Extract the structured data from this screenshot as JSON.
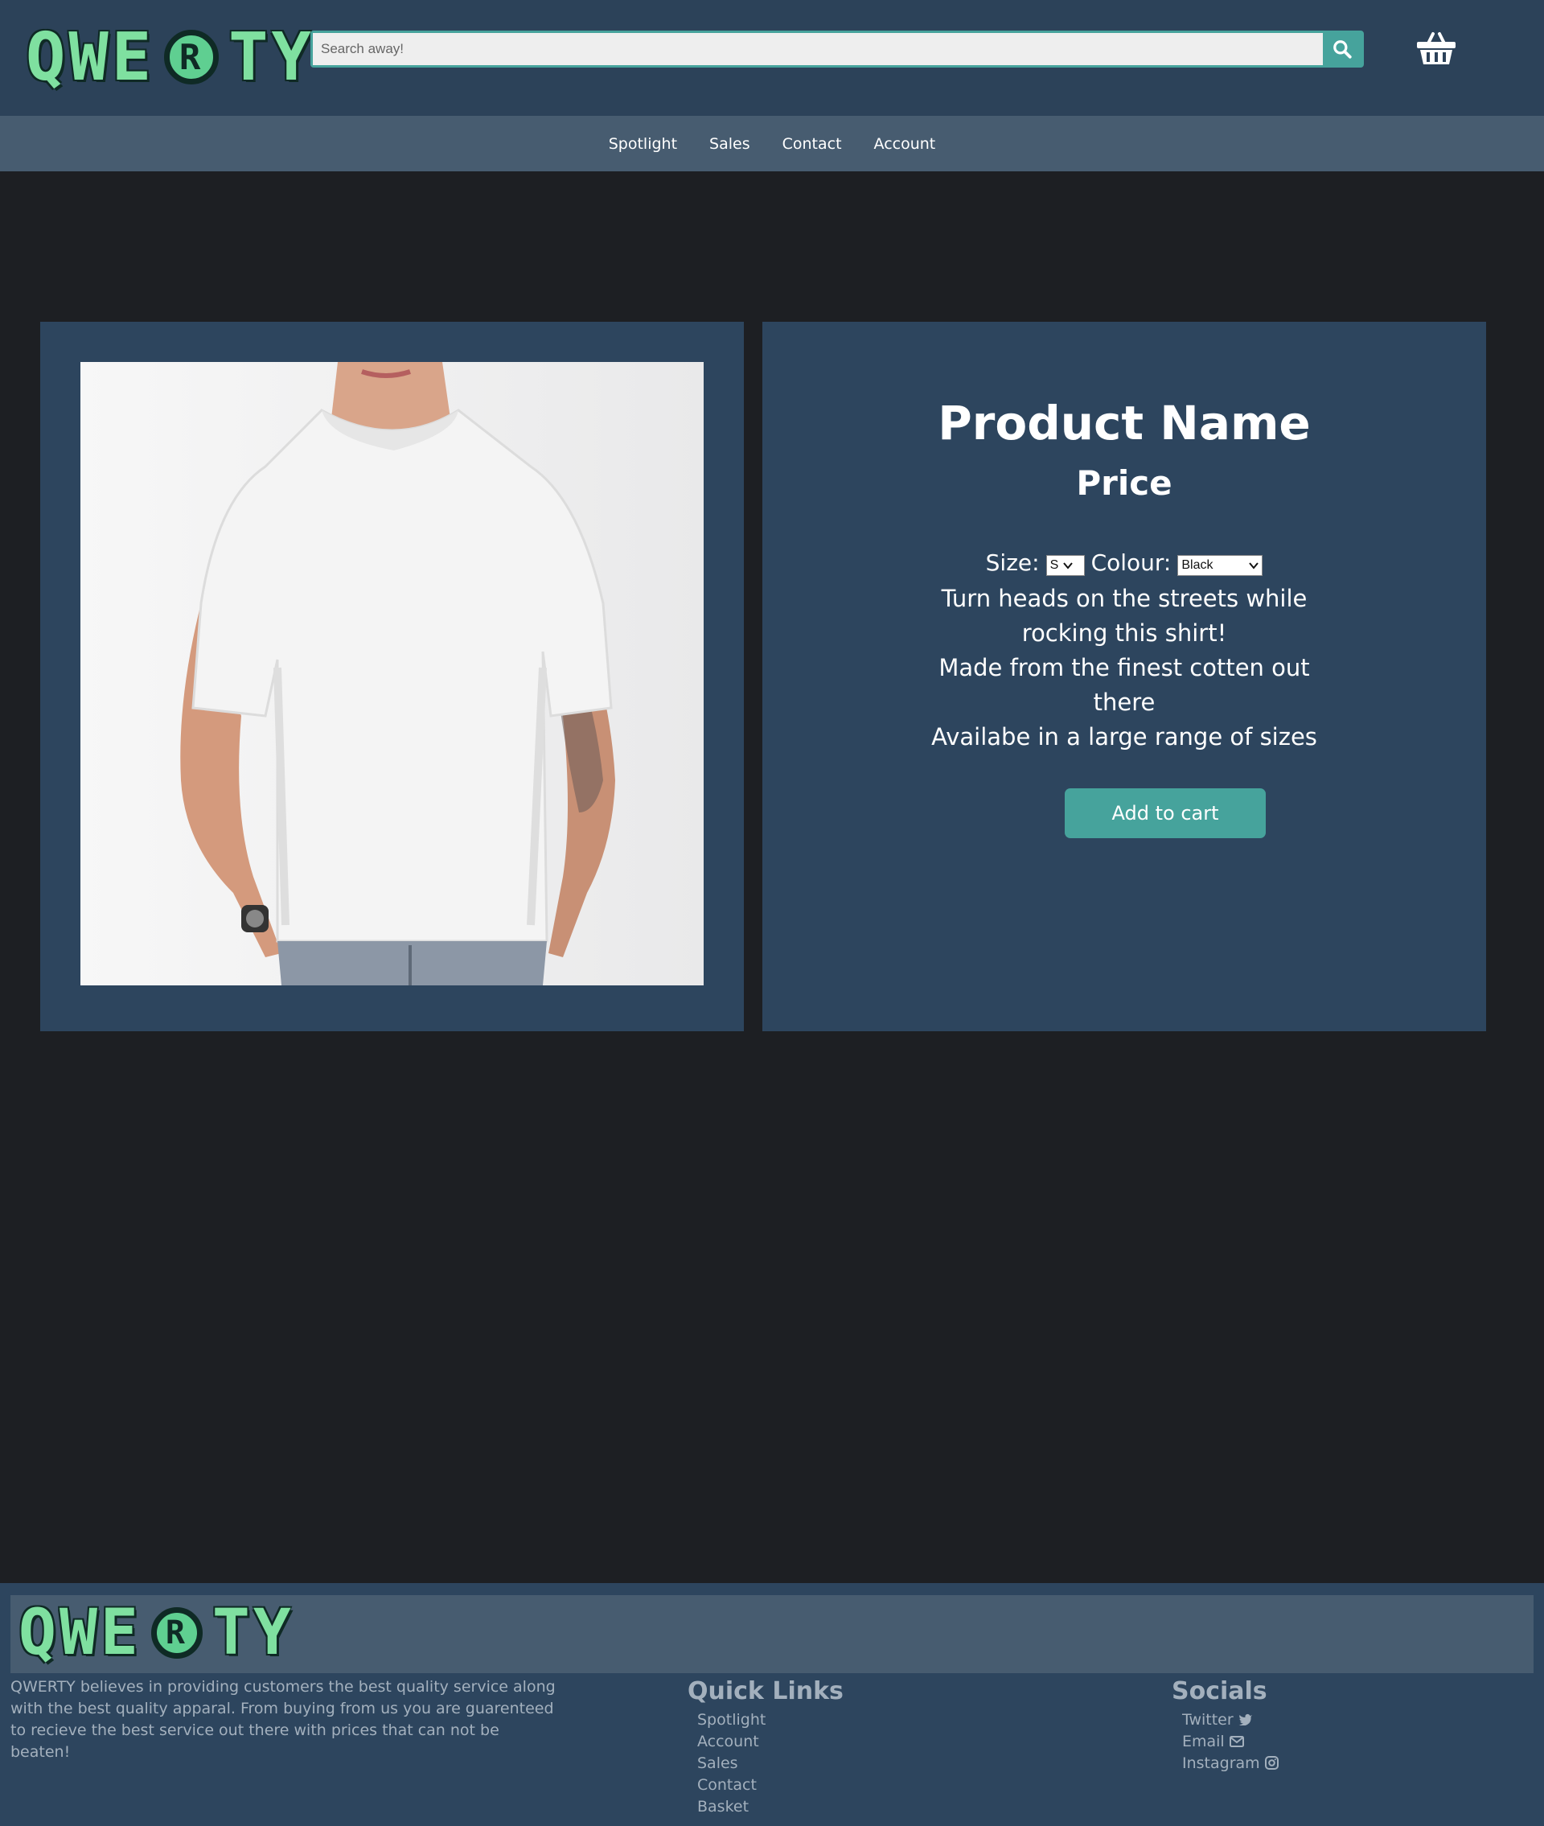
{
  "brand": {
    "logo_left": "QWE",
    "logo_mark": "R",
    "logo_right": "TY"
  },
  "header": {
    "search_placeholder": "Search away!"
  },
  "nav": {
    "items": [
      "Spotlight",
      "Sales",
      "Contact",
      "Account"
    ]
  },
  "product": {
    "name": "Product Name",
    "price": "Price",
    "size_label": "Size:",
    "size_value": "S",
    "colour_label": "Colour:",
    "colour_value": "Black",
    "description": [
      "Turn heads on the streets while rocking this shirt!",
      "Made from the finest cotten out there",
      "Availabe in a large range of sizes"
    ],
    "cart_button": "Add to cart"
  },
  "footer": {
    "about": "QWERTY believes in providing customers the best quality service along with the best quality apparal. From buying from us you are guarenteed to recieve the best service out there with prices that can not be beaten!",
    "quick_links_title": "Quick Links",
    "quick_links": [
      "Spotlight",
      "Account",
      "Sales",
      "Contact",
      "Basket"
    ],
    "socials_title": "Socials",
    "socials": [
      "Twitter",
      "Email",
      "Instagram"
    ]
  },
  "colors": {
    "header_bg": "#2c4259",
    "nav_bg": "#475c70",
    "page_bg": "#1d1f23",
    "card_bg": "#2d455e",
    "accent": "#46a39c",
    "logo_green": "#7fe0a0",
    "footer_text": "#a3b0bd"
  },
  "icons": [
    "search-icon",
    "basket-icon",
    "chevron-down-icon",
    "twitter-icon",
    "mail-icon",
    "instagram-icon"
  ]
}
